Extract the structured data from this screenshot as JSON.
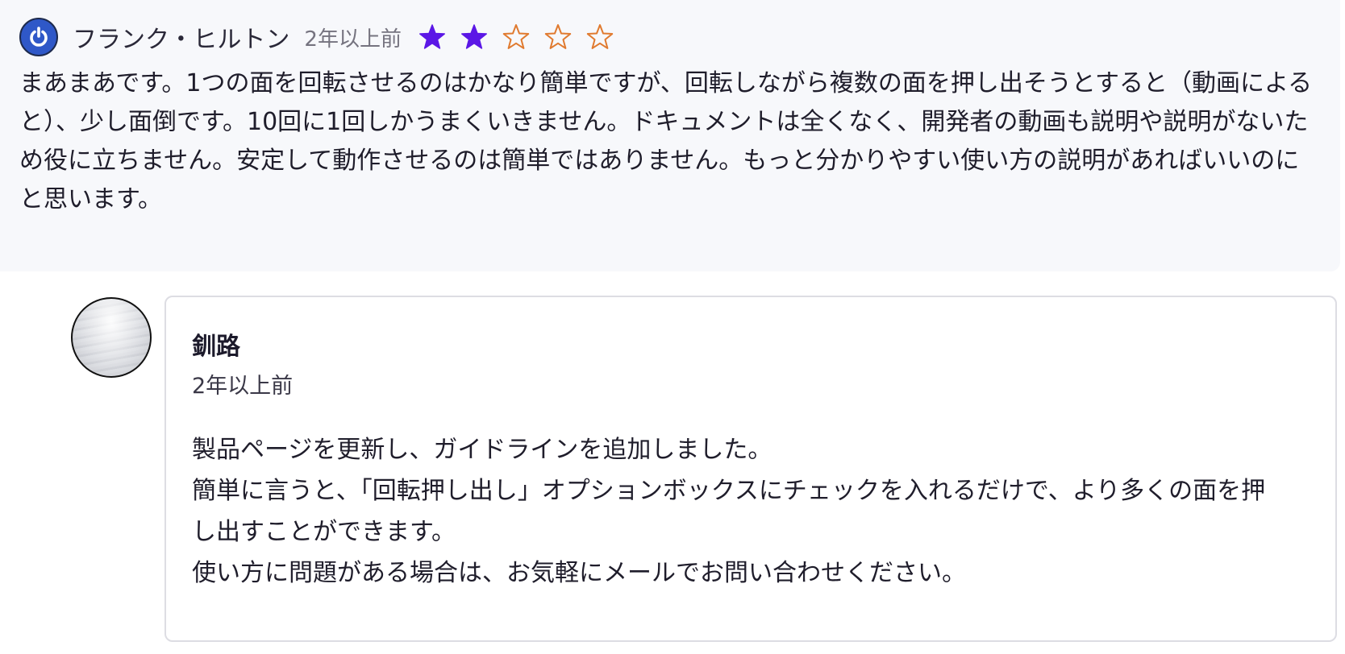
{
  "review": {
    "reviewer_name": "フランク・ヒルトン",
    "time": "2年以上前",
    "rating": 2,
    "max_rating": 5,
    "star_filled_color": "#5b17e6",
    "star_empty_color": "#e07a2f",
    "avatar_icon": "power-icon",
    "body": "まあまあです。1つの面を回転させるのはかなり簡単ですが、回転しながら複数の面を押し出そうとすると（動画によると）、少し面倒です。10回に1回しかうまくいきません。ドキュメントは全くなく、開発者の動画も説明や説明がないため役に立ちません。安定して動作させるのは簡単ではありません。もっと分かりやすい使い方の説明があればいいのにと思います。"
  },
  "reply": {
    "author": "釧路",
    "time": "2年以上前",
    "lines": [
      "製品ページを更新し、ガイドラインを追加しました。",
      "簡単に言うと、「回転押し出し」オプションボックスにチェックを入れるだけで、より多くの面を押し出すことができます。",
      "使い方に問題がある場合は、お気軽にメールでお問い合わせください。"
    ]
  }
}
